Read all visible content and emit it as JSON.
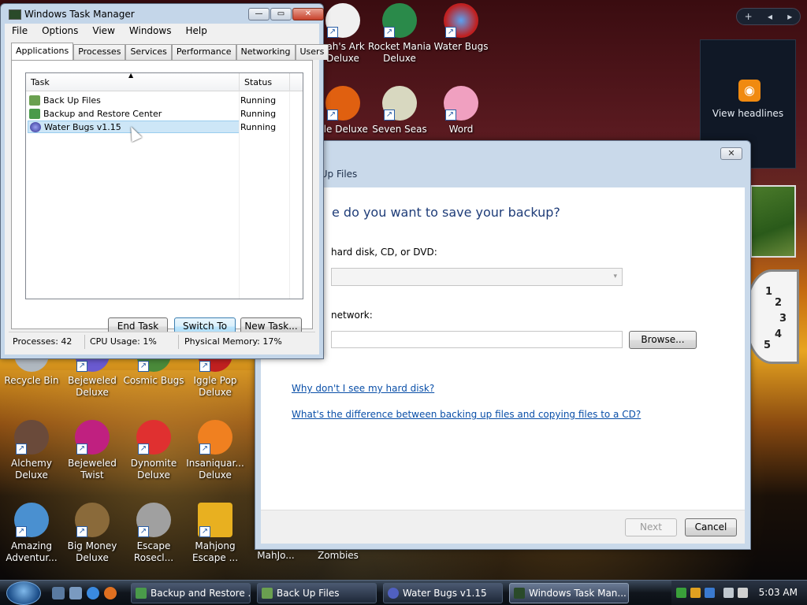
{
  "desktop": {
    "icons": [
      {
        "label": "oah's Ark\nDeluxe",
        "color": "#f0f0f0"
      },
      {
        "label": "Rocket Mania\nDeluxe",
        "color": "#2a8a4a"
      },
      {
        "label": "Water Bugs",
        "color": "#c02020"
      },
      {
        "label": "gle Deluxe",
        "color": "#e06010"
      },
      {
        "label": "Seven Seas",
        "color": "#d8d8c0"
      },
      {
        "label": "Word",
        "color": "#f0a0c0"
      },
      {
        "label": "Recycle Bin",
        "color": "#b0b8c0"
      },
      {
        "label": "Bejeweled\nDeluxe",
        "color": "#6a5ad0"
      },
      {
        "label": "Cosmic Bugs",
        "color": "#4a8a3a"
      },
      {
        "label": "Iggle Pop\nDeluxe",
        "color": "#c02020"
      },
      {
        "label": "Alchemy\nDeluxe",
        "color": "#6a4a3a"
      },
      {
        "label": "Bejeweled\nTwist",
        "color": "#c02080"
      },
      {
        "label": "Dynomite\nDeluxe",
        "color": "#e03030"
      },
      {
        "label": "Insaniquar...\nDeluxe",
        "color": "#f08020"
      },
      {
        "label": "Amazing\nAdventur...",
        "color": "#4a90d0"
      },
      {
        "label": "Big Money\nDeluxe",
        "color": "#8a6a3a"
      },
      {
        "label": "Escape\nRosecl...",
        "color": "#a0a0a0"
      },
      {
        "label": "Mahjong\nEscape ...",
        "color": "#e8b020"
      },
      {
        "label": "MahJo...",
        "color": "#303030"
      },
      {
        "label": "Zombies",
        "color": "#303030"
      }
    ],
    "sidebar_plus": "+",
    "feed_label": "View headlines",
    "clock_nums": [
      "1",
      "2",
      "3",
      "4",
      "5"
    ]
  },
  "backup": {
    "close_glyph": "✕",
    "crumb": "k Up Files",
    "heading": "e do you want to save your backup?",
    "option1_label": "hard disk, CD, or DVD:",
    "option2_label": "network:",
    "combo_arrow": "▾",
    "browse": "Browse...",
    "link1": "Why don't I see my hard disk?",
    "link2": "What's the difference between backing up files and copying files to a CD?",
    "next": "Next",
    "cancel": "Cancel"
  },
  "taskmgr": {
    "title": "Windows Task Manager",
    "min": "—",
    "max": "▭",
    "close": "✕",
    "menu": [
      "File",
      "Options",
      "View",
      "Windows",
      "Help"
    ],
    "tabs": [
      "Applications",
      "Processes",
      "Services",
      "Performance",
      "Networking",
      "Users"
    ],
    "col_task": "Task",
    "col_status": "Status",
    "rows": [
      {
        "task": "Back Up Files",
        "status": "Running"
      },
      {
        "task": "Backup and Restore Center",
        "status": "Running"
      },
      {
        "task": "Water Bugs v1.15",
        "status": "Running"
      }
    ],
    "end_task": "End Task",
    "switch_to": "Switch To",
    "new_task": "New Task...",
    "processes": "Processes: 42",
    "cpu": "CPU Usage: 1%",
    "memory": "Physical Memory: 17%"
  },
  "taskbar": {
    "buttons": [
      "Backup and Restore ...",
      "Back Up Files",
      "Water Bugs v1.15",
      "Windows Task Man..."
    ],
    "time": "5:03 AM"
  }
}
